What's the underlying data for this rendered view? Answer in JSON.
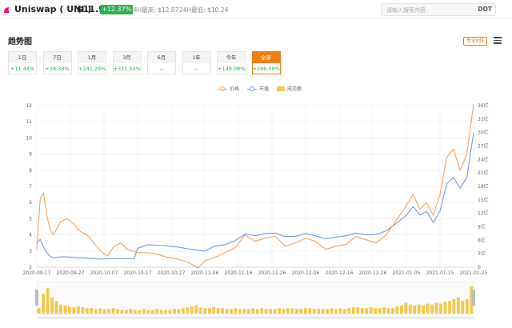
{
  "header": {
    "coin_name": "Uniswap ( UNI )",
    "price": "$11.98",
    "change": "+12.37%",
    "high_24h": "24H最高: $12.87",
    "low_24h": "24H最低: $10.24",
    "search_placeholder": "请输入搜索内容",
    "search_button": "DOT"
  },
  "section": {
    "title": "趋势图",
    "pro_button": "专业K线"
  },
  "tabs": [
    {
      "label": "1日",
      "change": "+11.44%"
    },
    {
      "label": "7日",
      "change": "+28.38%"
    },
    {
      "label": "1月",
      "change": "+241.29%"
    },
    {
      "label": "3月",
      "change": "+311.54%"
    },
    {
      "label": "6月",
      "change": "--"
    },
    {
      "label": "1年",
      "change": "--"
    },
    {
      "label": "今年",
      "change": "+149.08%"
    },
    {
      "label": "全部",
      "change": "+286.09%",
      "active": true
    }
  ],
  "colors": {
    "price": "#f4a261",
    "market_cap": "#6f9bd8",
    "volume": "#f2c94c",
    "accent": "#f07d12",
    "up": "#2bb24c"
  },
  "chart_data": {
    "type": "line",
    "legend": [
      "价格",
      "市值",
      "成交额"
    ],
    "x_ticks": [
      "2020-09-17",
      "2020-09-27",
      "2020-10-07",
      "2020-10-17",
      "2020-10-27",
      "2020-11-06",
      "2020-11-16",
      "2020-11-26",
      "2020-12-06",
      "2020-12-16",
      "2020-12-26",
      "2021-01-05",
      "2021-01-15",
      "2021-01-25"
    ],
    "x_range": [
      "2020-09-17",
      "2021-01-25"
    ],
    "y_left_ticks": [
      2,
      3,
      4,
      5,
      6,
      7,
      8,
      9,
      10,
      11,
      12
    ],
    "y_left_range": [
      2,
      12
    ],
    "y_right_ticks": [
      "0",
      "3亿",
      "6亿",
      "9亿",
      "12亿",
      "15亿",
      "18亿",
      "21亿",
      "24亿",
      "27亿",
      "30亿",
      "33亿",
      "36亿"
    ],
    "y_right_range": [
      0,
      36
    ],
    "grid": true,
    "legend_position": "top-center",
    "series": [
      {
        "name": "价格",
        "x": [
          "2020-09-17",
          "2020-09-18",
          "2020-09-19",
          "2020-09-20",
          "2020-09-21",
          "2020-09-22",
          "2020-09-24",
          "2020-09-26",
          "2020-09-28",
          "2020-09-30",
          "2020-10-02",
          "2020-10-04",
          "2020-10-06",
          "2020-10-08",
          "2020-10-10",
          "2020-10-12",
          "2020-10-14",
          "2020-10-17",
          "2020-10-20",
          "2020-10-23",
          "2020-10-26",
          "2020-10-29",
          "2020-11-01",
          "2020-11-04",
          "2020-11-06",
          "2020-11-09",
          "2020-11-12",
          "2020-11-15",
          "2020-11-18",
          "2020-11-21",
          "2020-11-24",
          "2020-11-27",
          "2020-11-30",
          "2020-12-03",
          "2020-12-06",
          "2020-12-09",
          "2020-12-12",
          "2020-12-15",
          "2020-12-18",
          "2020-12-21",
          "2020-12-24",
          "2020-12-27",
          "2020-12-30",
          "2021-01-02",
          "2021-01-05",
          "2021-01-07",
          "2021-01-09",
          "2021-01-11",
          "2021-01-13",
          "2021-01-15",
          "2021-01-17",
          "2021-01-19",
          "2021-01-21",
          "2021-01-23",
          "2021-01-25"
        ],
        "values": [
          3.1,
          6.2,
          6.6,
          5.2,
          4.3,
          4.0,
          4.8,
          5.0,
          4.7,
          4.2,
          4.0,
          3.5,
          3.0,
          2.7,
          3.3,
          3.5,
          3.1,
          2.9,
          2.9,
          2.8,
          2.6,
          2.5,
          2.3,
          1.95,
          2.4,
          2.6,
          2.9,
          3.2,
          4.0,
          3.6,
          3.8,
          3.9,
          3.3,
          3.5,
          3.8,
          3.6,
          3.1,
          3.3,
          3.4,
          3.9,
          3.7,
          3.5,
          4.0,
          4.9,
          5.8,
          6.5,
          5.6,
          6.0,
          5.2,
          6.5,
          8.8,
          9.3,
          8.0,
          9.0,
          12.1
        ]
      },
      {
        "name": "市值",
        "x": [
          "2020-09-17",
          "2020-09-18",
          "2020-09-19",
          "2020-09-20",
          "2020-09-21",
          "2020-09-22",
          "2020-09-24",
          "2020-09-26",
          "2020-09-28",
          "2020-09-30",
          "2020-10-02",
          "2020-10-04",
          "2020-10-06",
          "2020-10-08",
          "2020-10-10",
          "2020-10-12",
          "2020-10-14",
          "2020-10-16",
          "2020-10-17",
          "2020-10-20",
          "2020-10-23",
          "2020-10-26",
          "2020-10-29",
          "2020-11-01",
          "2020-11-04",
          "2020-11-06",
          "2020-11-09",
          "2020-11-12",
          "2020-11-15",
          "2020-11-18",
          "2020-11-21",
          "2020-11-24",
          "2020-11-27",
          "2020-11-30",
          "2020-12-03",
          "2020-12-06",
          "2020-12-09",
          "2020-12-12",
          "2020-12-15",
          "2020-12-18",
          "2020-12-21",
          "2020-12-24",
          "2020-12-27",
          "2020-12-30",
          "2021-01-02",
          "2021-01-05",
          "2021-01-07",
          "2021-01-09",
          "2021-01-11",
          "2021-01-13",
          "2021-01-15",
          "2021-01-17",
          "2021-01-19",
          "2021-01-21",
          "2021-01-23",
          "2021-01-25"
        ],
        "values": [
          5.3,
          6.2,
          4.5,
          3.2,
          2.4,
          2.1,
          2.3,
          2.3,
          2.2,
          2.1,
          2.0,
          1.9,
          1.8,
          1.9,
          1.9,
          1.9,
          1.9,
          1.9,
          4.2,
          5.0,
          4.9,
          4.7,
          4.5,
          4.1,
          3.8,
          3.6,
          4.7,
          5.0,
          5.9,
          7.4,
          7.0,
          7.5,
          7.6,
          6.8,
          6.9,
          7.5,
          7.0,
          6.3,
          6.7,
          7.0,
          7.6,
          7.2,
          7.3,
          8.1,
          9.8,
          11.6,
          13.5,
          11.6,
          12.4,
          10.0,
          12.5,
          18.6,
          20.0,
          17.6,
          20.0,
          30.0
        ]
      },
      {
        "name": "成交额",
        "values": [
          6,
          22,
          28,
          18,
          14,
          10,
          9,
          8,
          7,
          8,
          7,
          6,
          6,
          5,
          6,
          5,
          5,
          6,
          5,
          4,
          4,
          5,
          4,
          4,
          5,
          4,
          4,
          5,
          4,
          4,
          4,
          5,
          5,
          6,
          7,
          8,
          9,
          7,
          6,
          6,
          7,
          6,
          6,
          5,
          5,
          6,
          5,
          5,
          5,
          6,
          5,
          6,
          5,
          5,
          5,
          6,
          5,
          6,
          6,
          5,
          5,
          6,
          6,
          5,
          5,
          5,
          5,
          6,
          5,
          6,
          5,
          6,
          7,
          7,
          6,
          6,
          7,
          6,
          6,
          7,
          6,
          6,
          8,
          9,
          12,
          10,
          9,
          10,
          9,
          11,
          10,
          12,
          11,
          13,
          14,
          16,
          18,
          14,
          16,
          30
        ]
      }
    ]
  }
}
